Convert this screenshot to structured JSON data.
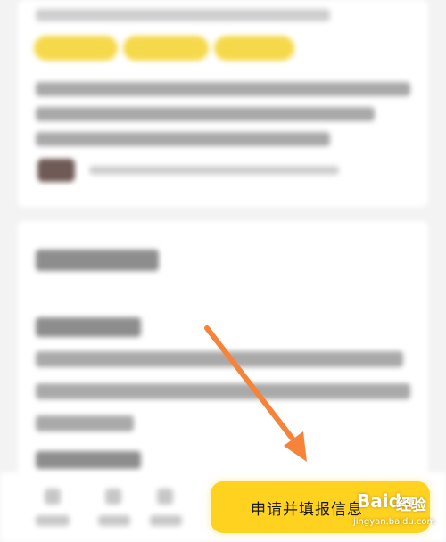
{
  "apply_button": {
    "label": "申请并填报信息"
  },
  "watermark": {
    "brand": "Baidu",
    "product": "经验",
    "url": "jingyan.baidu.com"
  },
  "colors": {
    "accent": "#ffd21f",
    "arrow": "#f5843a",
    "tag": "#f6d94a"
  }
}
